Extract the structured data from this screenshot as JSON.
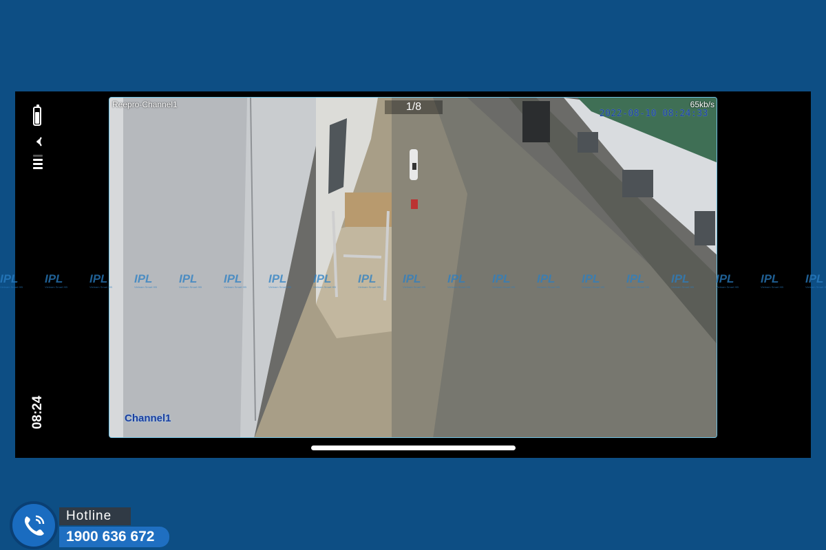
{
  "status_bar": {
    "time": "08:24",
    "icons": [
      "battery-icon",
      "wifi-icon",
      "cellular-signal-icon"
    ]
  },
  "camera": {
    "device_channel": "Reepro-Channel1",
    "page_indicator": "1/8",
    "bitrate": "65kb/s",
    "timestamp": "2022-08-10 08:24:33",
    "channel_label": "Channel1"
  },
  "watermark": {
    "text": "IPL",
    "subtext": "Vietnam Smart HB",
    "repeat": 19
  },
  "hotline": {
    "label": "Hotline",
    "number": "1900 636 672",
    "icon": "phone-icon"
  },
  "colors": {
    "page_background": "#0d4e84",
    "frame": "#000000",
    "overlay_date": "#1b3e9e",
    "hotline_number_bg": "#1f6fc1"
  }
}
